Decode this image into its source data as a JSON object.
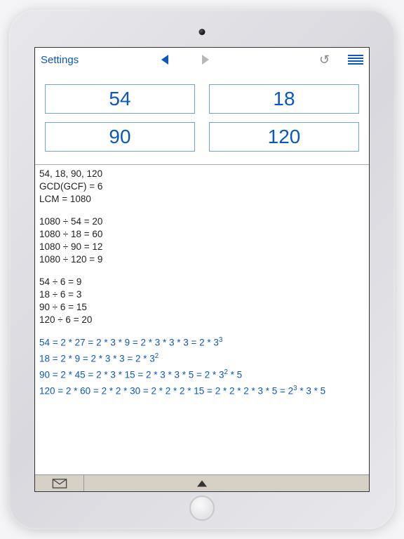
{
  "toolbar": {
    "settings_label": "Settings"
  },
  "inputs": {
    "a": "54",
    "b": "18",
    "c": "90",
    "d": "120"
  },
  "results": {
    "header": {
      "numbers": "54, 18, 90, 120",
      "gcd": "GCD(GCF) = 6",
      "lcm": "LCM = 1080"
    },
    "lcm_div": [
      "1080 ÷ 54 = 20",
      "1080 ÷ 18 = 60",
      "1080 ÷ 90 = 12",
      "1080 ÷ 120 = 9"
    ],
    "gcd_div": [
      "54 ÷ 6 = 9",
      "18 ÷ 6 = 3",
      "90 ÷ 6 = 15",
      "120 ÷ 6 = 20"
    ],
    "factorizations": [
      {
        "pre": "54 = 2 * 27 = 2 * 3 * 9 = 2 * 3 * 3 * 3 = 2 * 3",
        "sup": "3",
        "post": ""
      },
      {
        "pre": "18 = 2 * 9 = 2 * 3 * 3 = 2 * 3",
        "sup": "2",
        "post": ""
      },
      {
        "pre": "90 = 2 * 45 = 2 * 3 * 15 = 2 * 3 * 3 * 5 = 2 * 3",
        "sup": "2",
        "post": " * 5"
      },
      {
        "pre": "120 = 2 * 60 = 2 * 2 * 30 = 2 * 2 * 2 * 15 = 2 * 2 * 2 * 3 * 5 = 2",
        "sup": "3",
        "post": " * 3 * 5"
      }
    ]
  }
}
